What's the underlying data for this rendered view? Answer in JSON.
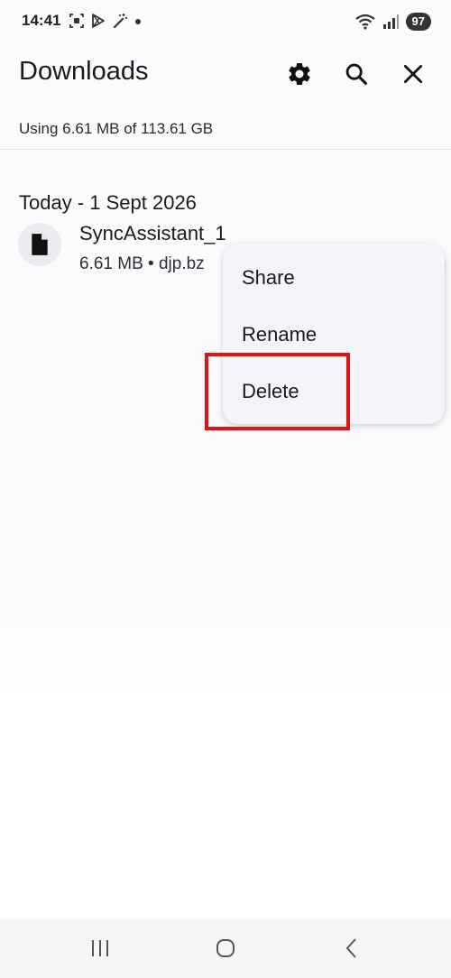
{
  "status_bar": {
    "time": "14:41",
    "battery": "97",
    "icons": [
      "screenshot-icon",
      "play-store-icon",
      "magic-wand-icon",
      "dot-icon",
      "wifi-icon",
      "signal-icon",
      "battery-icon"
    ]
  },
  "app_bar": {
    "title": "Downloads",
    "actions": [
      "gear-icon",
      "search-icon",
      "close-icon"
    ]
  },
  "storage": {
    "text": "Using 6.61 MB of 113.61 GB"
  },
  "downloads": {
    "section_header": "Today - 1 Sept 2026",
    "files": [
      {
        "name": "SyncAssistant_1",
        "meta": "6.61 MB • djp.bz",
        "icon": "document-icon"
      }
    ]
  },
  "context_menu": {
    "items": [
      {
        "label": "Share"
      },
      {
        "label": "Rename"
      },
      {
        "label": "Delete"
      }
    ],
    "highlight_color": "#e01414"
  },
  "nav_bar": {
    "buttons": [
      "recent-apps-icon",
      "home-icon",
      "back-icon"
    ]
  }
}
